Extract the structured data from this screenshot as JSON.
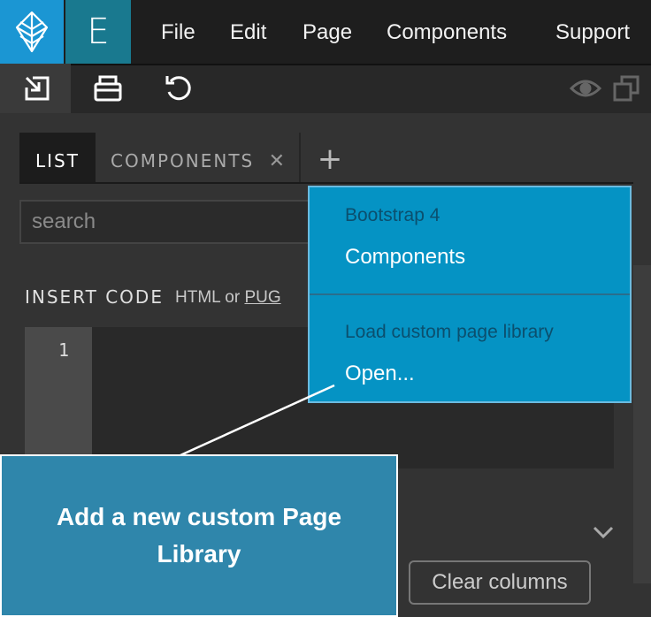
{
  "menubar": {
    "logo_icon": "pinecone-logo-icon",
    "e_label": "E",
    "items": [
      "File",
      "Edit",
      "Page",
      "Components",
      "Support"
    ]
  },
  "toolbar": {
    "icons": [
      "import-icon",
      "print-icon",
      "undo-icon",
      "eye-icon",
      "duplicate-icon"
    ]
  },
  "tabs": {
    "list": "LIST",
    "components": "COMPONENTS",
    "close": "✕",
    "add": "+"
  },
  "search": {
    "placeholder": "search"
  },
  "insert_code": {
    "label": "INSERT CODE",
    "sub_html": "HTML or ",
    "sub_pug": "PUG",
    "line_number": "1"
  },
  "dropdown": {
    "group1_header": "Bootstrap 4",
    "group1_item": "Components",
    "group2_header": "Load custom page library",
    "group2_item": "Open..."
  },
  "clear_columns": "Clear columns",
  "callout": "Add a new custom Page Library",
  "colors": {
    "logo_bg": "#1b96d3",
    "e_bg": "#19798f",
    "dropdown_bg": "#0593c4",
    "callout_bg": "#2f86ab"
  }
}
